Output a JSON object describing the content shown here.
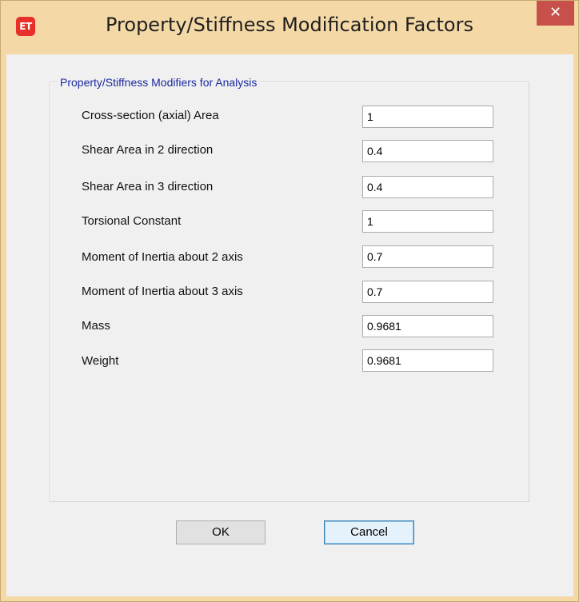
{
  "window": {
    "title": "Property/Stiffness Modification Factors",
    "app_icon_text": "ET",
    "close_glyph": "✕"
  },
  "group": {
    "label": "Property/Stiffness Modifiers for Analysis"
  },
  "rows": [
    {
      "label": "Cross-section (axial) Area",
      "value": "1"
    },
    {
      "label": "Shear Area in 2 direction",
      "value": "0.4"
    },
    {
      "label": "Shear Area in 3 direction",
      "value": "0.4"
    },
    {
      "label": "Torsional Constant",
      "value": "1"
    },
    {
      "label": "Moment of Inertia about 2 axis",
      "value": "0.7"
    },
    {
      "label": "Moment of Inertia about 3 axis",
      "value": "0.7"
    },
    {
      "label": "Mass",
      "value": "0.9681"
    },
    {
      "label": "Weight",
      "value": "0.9681"
    }
  ],
  "buttons": {
    "ok": "OK",
    "cancel": "Cancel"
  },
  "colors": {
    "frame": "#f4d9a6",
    "close_button": "#c7504a",
    "app_icon": "#e8302a",
    "group_label": "#1b2a9f"
  }
}
